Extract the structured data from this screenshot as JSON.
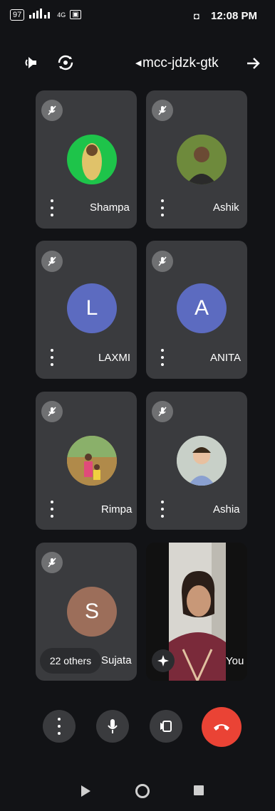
{
  "status_bar": {
    "time": "12:08 PM",
    "battery": "97",
    "network": "4G"
  },
  "top_bar": {
    "meeting_code": "mcc-jdzk-gtk"
  },
  "participants": [
    {
      "name": "Ashik",
      "avatar_type": "photo",
      "avatar_color": "#4a6b2a"
    },
    {
      "name": "Shampa",
      "avatar_type": "photo",
      "avatar_color": "#1ec44a"
    },
    {
      "name": "ANITA",
      "avatar_type": "initial",
      "initial": "A",
      "avatar_color": "#5c6bc0"
    },
    {
      "name": "LAXMI",
      "avatar_type": "initial",
      "initial": "L",
      "avatar_color": "#5c6bc0"
    },
    {
      "name": "Ashia",
      "avatar_type": "photo",
      "avatar_color": "#9aa8a0"
    },
    {
      "name": "Rimpa",
      "avatar_type": "photo",
      "avatar_color": "#c9a24a"
    },
    {
      "name": "You",
      "avatar_type": "video"
    },
    {
      "name": "Sujata",
      "avatar_type": "initial",
      "initial": "S",
      "avatar_color": "#9c6e5a"
    }
  ],
  "others_label": "22 others",
  "colors": {
    "hangup": "#ea4335",
    "tile": "#3a3b3e",
    "background": "#121316"
  }
}
